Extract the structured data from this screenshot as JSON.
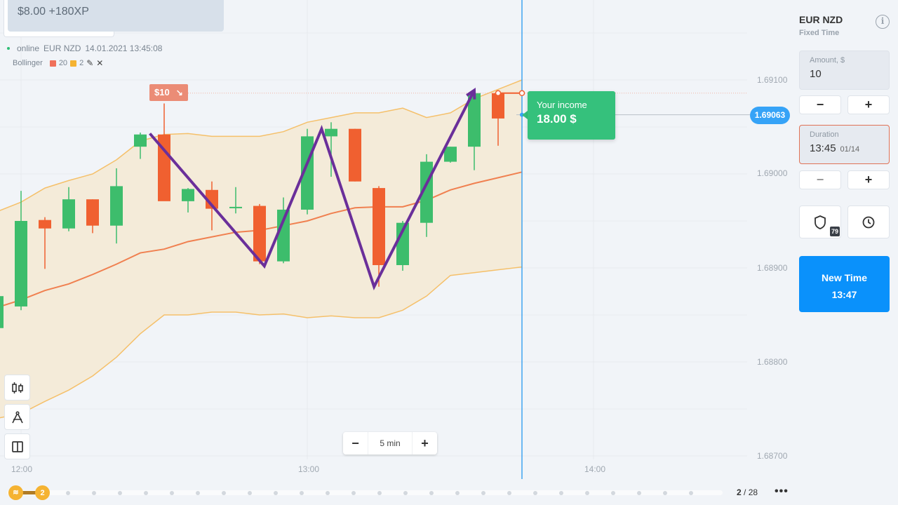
{
  "balance": {
    "text": "$8.00 +180XP"
  },
  "status": {
    "state": "online",
    "asset": "EUR NZD",
    "datetime": "14.01.2021 13:45:08"
  },
  "indicator": {
    "name": "Bollinger",
    "period": "20",
    "deviation": "2",
    "colors": {
      "period": "#f0705a",
      "deviation": "#f5b332"
    }
  },
  "toolbar": {
    "icons": [
      "candlestick-chart-icon",
      "drawing-compass-icon",
      "split-layout-icon"
    ]
  },
  "zoom_control": {
    "minus": "−",
    "label": "5 min",
    "plus": "+"
  },
  "bet_marker": {
    "label": "$10",
    "direction": "down",
    "arrow": "↘"
  },
  "income": {
    "label": "Your income",
    "value": "18.00 $"
  },
  "current_price": "1.69063",
  "timeline": {
    "start_icon": "stack-icon",
    "level": "2",
    "page": "2",
    "total": "28",
    "more": "•••"
  },
  "panel": {
    "asset": "EUR NZD",
    "mode": "Fixed Time",
    "amount": {
      "label": "Amount, $",
      "value": "10"
    },
    "amount_minus": "−",
    "amount_plus": "+",
    "duration": {
      "label": "Duration",
      "time": "13:45",
      "date": "01/14"
    },
    "duration_minus": "−",
    "duration_plus": "+",
    "insurance_badge": "79",
    "new_time": {
      "line1": "New Time",
      "line2": "13:47"
    }
  },
  "chart_data": {
    "type": "candlestick",
    "title": "EUR NZD",
    "interval": "5 min",
    "x_ticks": [
      "12:00",
      "13:00",
      "14:00"
    ],
    "y_ticks": [
      "1.69100",
      "1.69000",
      "1.68900",
      "1.68800",
      "1.68700"
    ],
    "ylim": [
      1.6869,
      1.69185
    ],
    "colors": {
      "up": "#3dbd6c",
      "down": "#f06030",
      "band_fill": "#f4ebd9",
      "band_line": "#f5c06a",
      "mid_line": "#f08050",
      "pattern": "#6a2f9a",
      "now_line": "#3fa3f0"
    },
    "candles": [
      {
        "t": "11:55",
        "o": 1.68836,
        "h": 1.6887,
        "l": 1.6882,
        "c": 1.6887
      },
      {
        "t": "12:00",
        "o": 1.68859,
        "h": 1.68982,
        "l": 1.68855,
        "c": 1.6895
      },
      {
        "t": "12:05",
        "o": 1.68951,
        "h": 1.68954,
        "l": 1.68899,
        "c": 1.68942
      },
      {
        "t": "12:10",
        "o": 1.68942,
        "h": 1.68986,
        "l": 1.68939,
        "c": 1.68973
      },
      {
        "t": "12:15",
        "o": 1.68973,
        "h": 1.68973,
        "l": 1.68937,
        "c": 1.68945
      },
      {
        "t": "12:20",
        "o": 1.68945,
        "h": 1.69006,
        "l": 1.68926,
        "c": 1.68987
      },
      {
        "t": "12:25",
        "o": 1.69029,
        "h": 1.69044,
        "l": 1.69016,
        "c": 1.69042
      },
      {
        "t": "12:30",
        "o": 1.69042,
        "h": 1.69075,
        "l": 1.68987,
        "c": 1.68971
      },
      {
        "t": "12:35",
        "o": 1.68971,
        "h": 1.68985,
        "l": 1.68959,
        "c": 1.68984
      },
      {
        "t": "12:40",
        "o": 1.68983,
        "h": 1.68992,
        "l": 1.6894,
        "c": 1.68963
      },
      {
        "t": "12:45",
        "o": 1.68965,
        "h": 1.68986,
        "l": 1.68958,
        "c": 1.68965
      },
      {
        "t": "12:50",
        "o": 1.68966,
        "h": 1.68968,
        "l": 1.68904,
        "c": 1.68907
      },
      {
        "t": "12:55",
        "o": 1.68907,
        "h": 1.68975,
        "l": 1.68905,
        "c": 1.68962
      },
      {
        "t": "13:00",
        "o": 1.68962,
        "h": 1.69048,
        "l": 1.68957,
        "c": 1.6904
      },
      {
        "t": "13:05",
        "o": 1.6904,
        "h": 1.69055,
        "l": 1.68997,
        "c": 1.69048
      },
      {
        "t": "13:10",
        "o": 1.69048,
        "h": 1.69048,
        "l": 1.68992,
        "c": 1.68992
      },
      {
        "t": "13:15",
        "o": 1.68985,
        "h": 1.68987,
        "l": 1.6888,
        "c": 1.68903
      },
      {
        "t": "13:20",
        "o": 1.68903,
        "h": 1.6895,
        "l": 1.68897,
        "c": 1.68948
      },
      {
        "t": "13:25",
        "o": 1.68948,
        "h": 1.69021,
        "l": 1.68933,
        "c": 1.69013
      },
      {
        "t": "13:30",
        "o": 1.69013,
        "h": 1.69029,
        "l": 1.69012,
        "c": 1.69029
      },
      {
        "t": "13:35",
        "o": 1.69029,
        "h": 1.69086,
        "l": 1.69004,
        "c": 1.69086
      },
      {
        "t": "13:40",
        "o": 1.69086,
        "h": 1.69086,
        "l": 1.6903,
        "c": 1.69059
      }
    ],
    "bollinger": {
      "upper": [
        1.6896,
        1.6897,
        1.68985,
        1.68993,
        1.69,
        1.69015,
        1.69035,
        1.69042,
        1.69043,
        1.6904,
        1.6904,
        1.6904,
        1.69045,
        1.69055,
        1.6906,
        1.69065,
        1.69065,
        1.6907,
        1.6906,
        1.69065,
        1.6908,
        1.6909
      ],
      "middle": [
        1.68858,
        1.68866,
        1.68876,
        1.68883,
        1.68893,
        1.68904,
        1.68916,
        1.6892,
        1.68928,
        1.68933,
        1.68938,
        1.6894,
        1.68945,
        1.6895,
        1.68958,
        1.68964,
        1.68965,
        1.68965,
        1.68972,
        1.68983,
        1.6899,
        1.68996
      ],
      "lower": [
        1.6874,
        1.68745,
        1.68758,
        1.6877,
        1.68785,
        1.68805,
        1.6883,
        1.6885,
        1.6885,
        1.68853,
        1.68853,
        1.6885,
        1.68851,
        1.68847,
        1.68849,
        1.68847,
        1.68847,
        1.68855,
        1.6887,
        1.68892,
        1.68895,
        1.68898
      ]
    },
    "pattern_points": [
      {
        "t": "12:27",
        "p": 1.69043
      },
      {
        "t": "12:51",
        "p": 1.68902
      },
      {
        "t": "13:03",
        "p": 1.69048
      },
      {
        "t": "13:14",
        "p": 1.6888
      },
      {
        "t": "13:35",
        "p": 1.69089
      }
    ],
    "bet_level": 1.69086,
    "now_time": "13:45"
  }
}
